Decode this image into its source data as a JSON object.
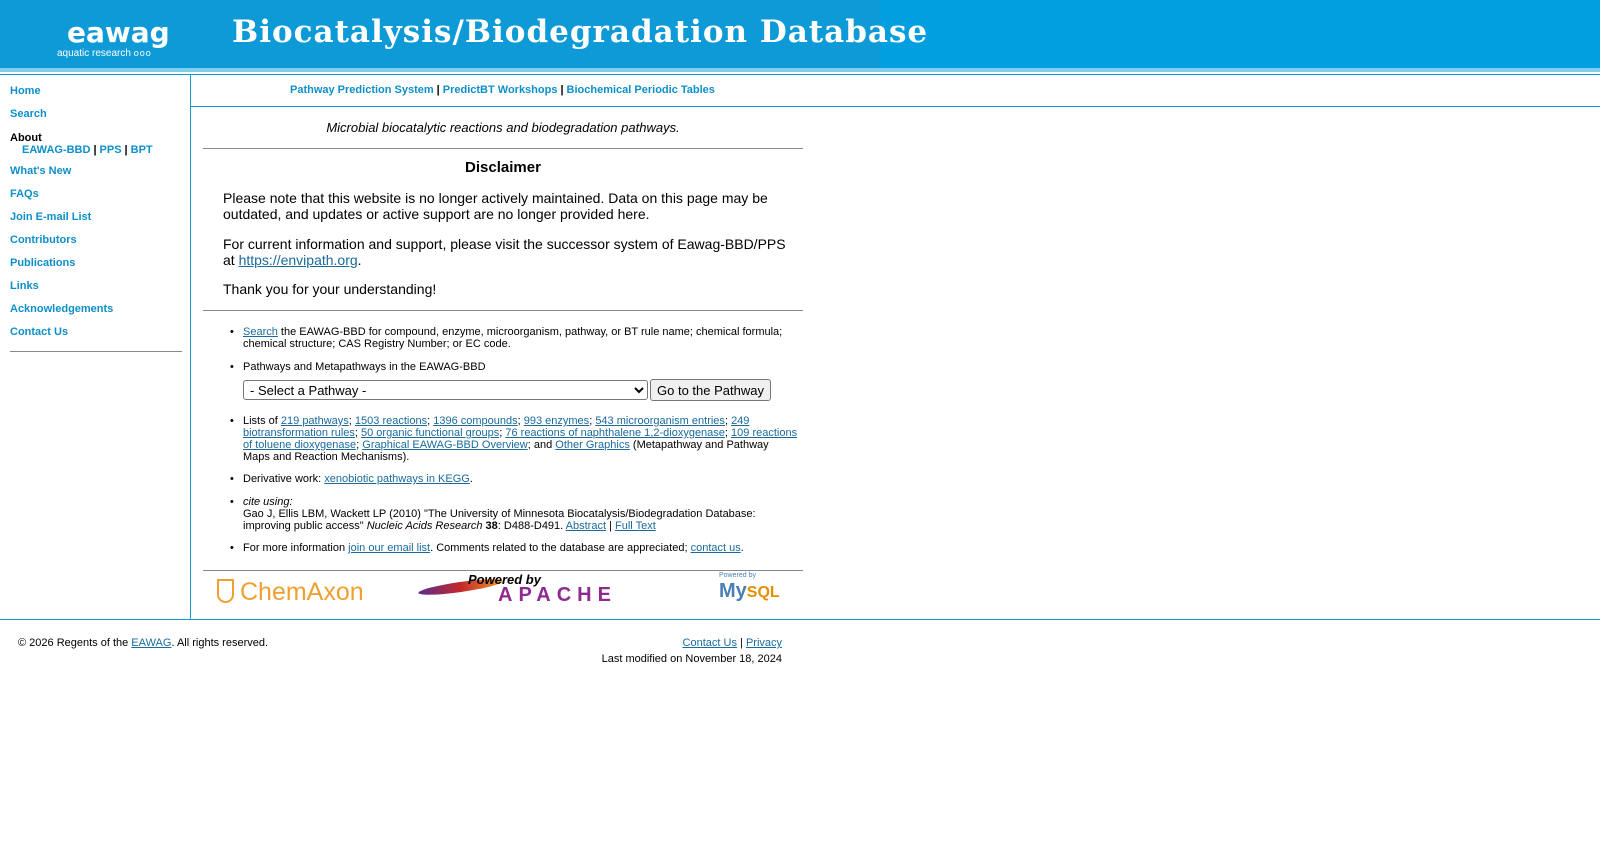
{
  "header": {
    "logo_word": "eawag",
    "logo_sub": "aquatic research",
    "logo_dots": "ooo",
    "site_title": "Biocatalysis/Biodegradation Database"
  },
  "sidebar": {
    "items": [
      {
        "label": "Home"
      },
      {
        "label": "Search"
      },
      {
        "label": "What's New"
      },
      {
        "label": "FAQs"
      },
      {
        "label": "Join E-mail List"
      },
      {
        "label": "Contributors"
      },
      {
        "label": "Publications"
      },
      {
        "label": "Links"
      },
      {
        "label": "Acknowledgements"
      },
      {
        "label": "Contact Us"
      }
    ],
    "about_label": "About",
    "about_links": [
      "EAWAG-BBD",
      "PPS",
      "BPT"
    ],
    "separator": "|"
  },
  "topnav": {
    "links": [
      "Pathway Prediction System",
      "PredictBT Workshops",
      "Biochemical Periodic Tables"
    ],
    "separator": "|"
  },
  "main": {
    "tagline": "Microbial biocatalytic reactions and biodegradation pathways.",
    "disclaimer_title": "Disclaimer",
    "disclaimer_p1": "Please note that this website is no longer actively maintained. Data on this page may be outdated, and updates or active support are no longer provided here.",
    "disclaimer_p2_text": "For current information and support, please visit the successor system of Eawag-BBD/PPS at ",
    "disclaimer_p2_link": "https://envipath.org",
    "disclaimer_p2_end": ".",
    "disclaimer_p3": "Thank you for your understanding!",
    "bullet_dot": "•",
    "search_link": "Search",
    "search_text": " the EAWAG-BBD for compound, enzyme, microorganism, pathway, or BT rule name; chemical formula; chemical structure; CAS Registry Number; or EC code.",
    "pathways_heading": "Pathways and Metapathways in the EAWAG-BBD",
    "pathway_select_value": "- Select a Pathway -",
    "go_button": "Go to the Pathway",
    "lists_prefix": "Lists of ",
    "list_links": [
      "219 pathways",
      "1503 reactions",
      "1396 compounds",
      "993 enzymes",
      "543 microorganism entries",
      "249 biotransformation rules",
      "50 organic functional groups",
      "76 reactions of naphthalene 1,2-dioxygenase",
      "109 reactions of toluene dioxygenase",
      "Graphical EAWAG-BBD Overview"
    ],
    "lists_and": "; and ",
    "other_graphics_link": "Other Graphics",
    "lists_suffix": " (Metapathway and Pathway Maps and Reaction Mechanisms).",
    "derivative_text": "Derivative work: ",
    "derivative_link": "xenobiotic pathways in KEGG",
    "derivative_end": ".",
    "cite_label": "cite using:",
    "citation_text": "Gao J, Ellis LBM, Wackett LP (2010) \"The University of Minnesota Biocatalysis/Biodegradation Database: improving public access\" ",
    "citation_journal": "Nucleic Acids Research",
    "citation_volume": "38",
    "citation_pages": ": D488-D491. ",
    "abstract_link": "Abstract",
    "fulltext_link": "Full Text",
    "more_info_text": "For more information ",
    "email_list_link": "join our email list",
    "comments_text": ". Comments related to the database are appreciated; ",
    "contact_link": "contact us",
    "contact_end": "."
  },
  "logos": {
    "chemaxon": "ChemAxon",
    "apache_powered": "Powered by",
    "apache_word": "APACHE",
    "mysql_powered": "Powered by",
    "mysql_my": "My",
    "mysql_sql": "SQL"
  },
  "footer": {
    "copyright_prefix": "© 2026 Regents of the ",
    "eawag_link": "EAWAG",
    "copyright_suffix": ". All rights reserved.",
    "contact_link": "Contact Us",
    "privacy_link": "Privacy",
    "separator": "|",
    "last_modified": "Last modified on November 18, 2024"
  }
}
